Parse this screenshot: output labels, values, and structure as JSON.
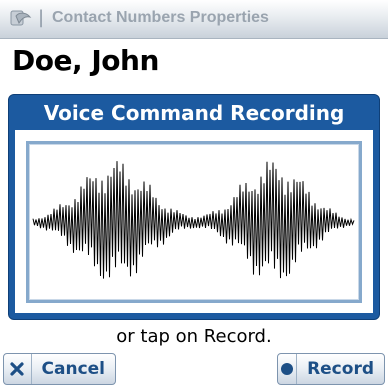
{
  "titlebar": {
    "title": "Contact Numbers Properties",
    "app_icon": "palm-app-icon"
  },
  "contact": {
    "name": "Doe, John"
  },
  "recording_panel": {
    "heading": "Voice Command Recording"
  },
  "hint": "or tap on Record.",
  "buttons": {
    "cancel": {
      "label": "Cancel",
      "icon": "close-x-icon"
    },
    "record": {
      "label": "Record",
      "icon": "record-dot-icon"
    }
  },
  "colors": {
    "panel_blue": "#1c5aa0",
    "button_text": "#1d4f86",
    "frame_border": "#86a9cc"
  }
}
